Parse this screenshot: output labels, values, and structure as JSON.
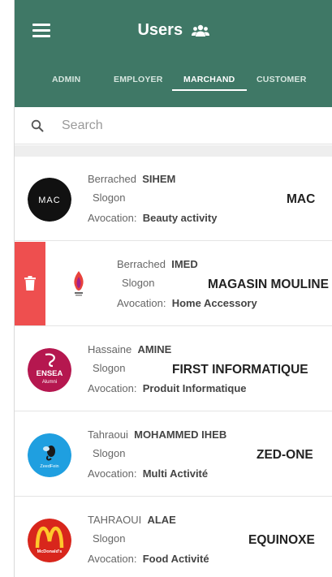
{
  "header": {
    "title": "Users",
    "title_icon": "users-group-icon",
    "background": "#3f7866"
  },
  "tabs": [
    {
      "label": "ADMIN",
      "active": false
    },
    {
      "label": "EMPLOYER",
      "active": false
    },
    {
      "label": "MARCHAND",
      "active": true
    },
    {
      "label": "CUSTOMER",
      "active": false
    }
  ],
  "search": {
    "placeholder": "Search",
    "value": ""
  },
  "labels": {
    "slogan": "Slogon",
    "avocation": "Avocation:"
  },
  "users": [
    {
      "first_name": "Berrached",
      "last_name": "SIHEM",
      "slogan": "MAC",
      "avocation": "Beauty activity",
      "logo": "mac-logo",
      "logo_text": "MAC",
      "swiped": false
    },
    {
      "first_name": "Berrached",
      "last_name": "IMED",
      "slogan": "MAGASIN MOULINE",
      "avocation": "Home Accessory",
      "logo": "flame-logo",
      "swiped": true
    },
    {
      "first_name": "Hassaine",
      "last_name": "AMINE",
      "slogan": "FIRST INFORMATIQUE",
      "avocation": "Produit Informatique",
      "logo": "ensea-logo",
      "logo_text": "ENSEA",
      "logo_subtext": "Alumni",
      "swiped": false
    },
    {
      "first_name": "Tahraoui",
      "last_name": "MOHAMMED IHEB",
      "slogan": "ZED-ONE",
      "avocation": "Multi Activité",
      "logo": "bee-logo",
      "logo_text": "ZeedFein",
      "swiped": false
    },
    {
      "first_name": "TAHRAOUI",
      "last_name": "ALAE",
      "slogan": "EQUINOXE",
      "avocation": "Food Activité",
      "logo": "mcdonalds-logo",
      "logo_text": "McDonald's",
      "swiped": false
    }
  ],
  "colors": {
    "accent": "#3f7866",
    "delete": "#ee4f4f"
  }
}
